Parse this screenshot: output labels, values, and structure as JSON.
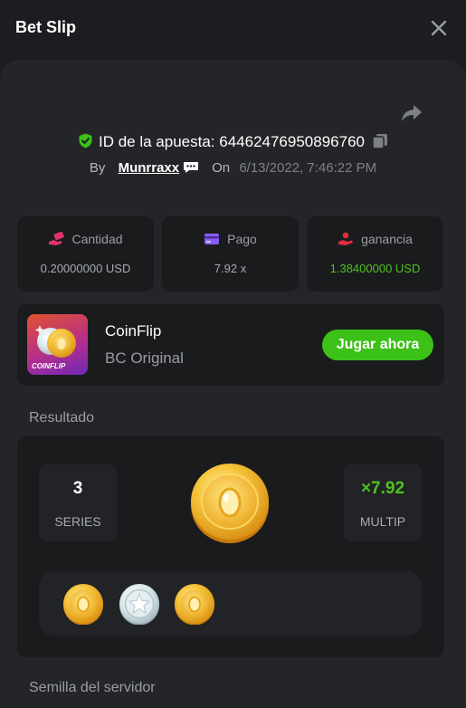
{
  "header": {
    "title": "Bet Slip"
  },
  "bet": {
    "id_label": "ID de la apuesta: 64462476950896760",
    "by_label": "By",
    "user": "Munrraxx",
    "on_label": "On",
    "date": "6/13/2022, 7:46:22 PM"
  },
  "stats": [
    {
      "label": "Cantidad",
      "value": "0.20000000 USD",
      "icon": "money-hand-icon",
      "color": "#e0336e"
    },
    {
      "label": "Pago",
      "value": "7.92 x",
      "icon": "card-icon",
      "color": "#8a5cf6"
    },
    {
      "label": "ganancia",
      "value": "1.38400000 USD",
      "icon": "profit-hand-icon",
      "color": "#e02d3c"
    }
  ],
  "game": {
    "name": "CoinFlip",
    "subtitle": "BC Original",
    "thumb_label": "COINFLIP",
    "play_label": "Jugar ahora"
  },
  "result": {
    "section_title": "Resultado",
    "series_value": "3",
    "series_label": "SERIES",
    "multiplier_value": "×7.92",
    "multiplier_label": "MULTIP",
    "coins": [
      "gold",
      "silver",
      "gold"
    ]
  },
  "server_seed": {
    "section_title": "Semilla del servidor"
  },
  "colors": {
    "accent_green": "#3bc117",
    "background": "#1c1d20",
    "panel": "#242528",
    "card": "#1a1b1d"
  }
}
